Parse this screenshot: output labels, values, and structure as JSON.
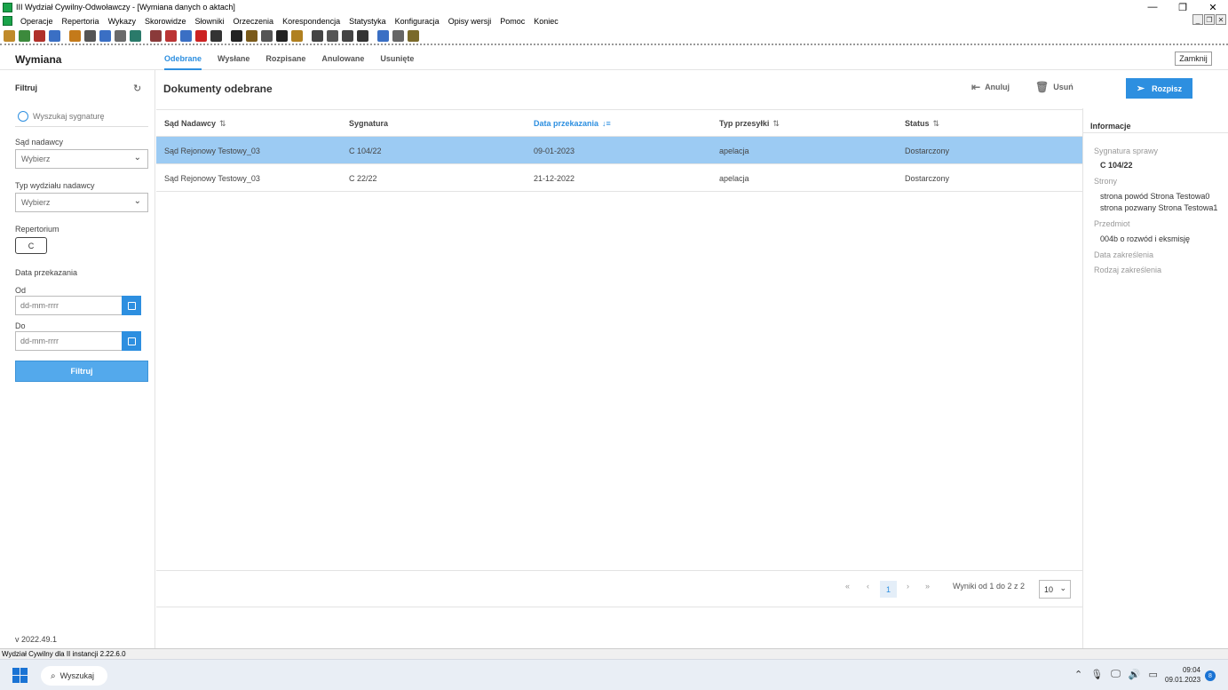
{
  "window": {
    "title": "III Wydział Cywilny-Odwoławczy - [Wymiana danych o aktach]"
  },
  "menu": [
    "Operacje",
    "Repertoria",
    "Wykazy",
    "Skorowidze",
    "Słowniki",
    "Orzeczenia",
    "Korespondencja",
    "Statystyka",
    "Konfiguracja",
    "Opisy wersji",
    "Pomoc",
    "Koniec"
  ],
  "toolbar_colors": [
    "#c08a2a",
    "#3c8a3c",
    "#b0302a",
    "#3a6fc4",
    "#c47a1a",
    "#555555",
    "#3a6fc4",
    "#6a6a6a",
    "#2a7a6a",
    "#8a3a3a",
    "#b33",
    "#3a6fc4",
    "#cc2222",
    "#333",
    "#222",
    "#7a5a1a",
    "#555",
    "#222",
    "#b08020",
    "#444",
    "#555",
    "#444",
    "#333",
    "#3a6fc4",
    "#666",
    "#7a6a2a"
  ],
  "app": {
    "title": "Wymiana",
    "close_label": "Zamknij"
  },
  "tabs": [
    "Odebrane",
    "Wysłane",
    "Rozpisane",
    "Anulowane",
    "Usunięte"
  ],
  "sidebar": {
    "filter_title": "Filtruj",
    "search_placeholder": "Wyszukaj sygnaturę",
    "sad_label": "Sąd nadawcy",
    "sad_value": "Wybierz",
    "typ_label": "Typ wydziału nadawcy",
    "typ_value": "Wybierz",
    "rep_label": "Repertorium",
    "rep_value": "C",
    "date_label": "Data przekazania",
    "od_label": "Od",
    "do_label": "Do",
    "date_placeholder": "dd-mm-rrrr",
    "filter_button": "Filtruj",
    "version": "v 2022.49.1"
  },
  "main": {
    "title": "Dokumenty odebrane",
    "anuluj": "Anuluj",
    "usun": "Usuń",
    "rozpisz": "Rozpisz",
    "columns": [
      "Sąd Nadawcy",
      "Sygnatura",
      "Data przekazania",
      "Typ przesyłki",
      "Status"
    ],
    "rows": [
      [
        "Sąd Rejonowy Testowy_03",
        "C 104/22",
        "09-01-2023",
        "apelacja",
        "Dostarczony"
      ],
      [
        "Sąd Rejonowy Testowy_03",
        "C 22/22",
        "21-12-2022",
        "apelacja",
        "Dostarczony"
      ]
    ],
    "pager": {
      "first": "«",
      "prev": "‹",
      "page": "1",
      "next": "›",
      "last": "»",
      "summary": "Wyniki od 1 do 2 z 2",
      "page_size": "10"
    }
  },
  "info": {
    "title": "Informacje",
    "sygnatura_label": "Sygnatura sprawy",
    "sygnatura_value": "C 104/22",
    "strony_label": "Strony",
    "strona1": "strona powód Strona Testowa0",
    "strona2": "strona pozwany Strona Testowa1",
    "przedmiot_label": "Przedmiot",
    "przedmiot_value": "004b o rozwód i eksmisję",
    "data_zakr_label": "Data zakreślenia",
    "rodzaj_zakr_label": "Rodzaj zakreślenia"
  },
  "statusbar": "Wydział Cywilny dla II instancji 2.22.6.0",
  "taskbar": {
    "search": "Wyszukaj",
    "time": "09:04",
    "date": "09.01.2023",
    "notifications": "8"
  }
}
